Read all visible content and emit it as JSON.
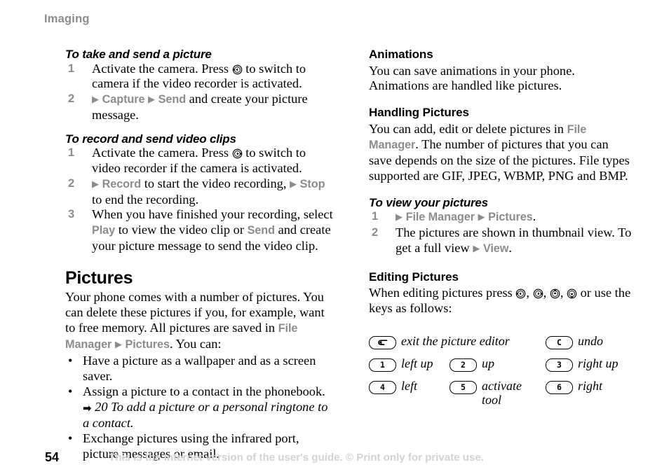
{
  "header": {
    "running_head": "Imaging"
  },
  "left_column": {
    "proc_take_send": {
      "heading": "To take and send a picture",
      "steps": [
        {
          "num": "1",
          "parts": [
            {
              "t": "text",
              "v": "Activate the camera. Press "
            },
            {
              "t": "navkey",
              "v": "nav-key-left"
            },
            {
              "t": "text",
              "v": " to switch to camera if the video recorder is activated."
            }
          ]
        },
        {
          "num": "2",
          "parts": [
            {
              "t": "arrow",
              "v": "▶"
            },
            {
              "t": "kw",
              "v": "Capture"
            },
            {
              "t": "arrow",
              "v": "▶"
            },
            {
              "t": "kw",
              "v": "Send"
            },
            {
              "t": "text",
              "v": " and create your picture message."
            }
          ]
        }
      ]
    },
    "proc_record_send": {
      "heading": "To record and send video clips",
      "steps": [
        {
          "num": "1",
          "parts": [
            {
              "t": "text",
              "v": "Activate the camera. Press "
            },
            {
              "t": "navkey",
              "v": "nav-key-right"
            },
            {
              "t": "text",
              "v": " to switch to video recorder if the camera is activated."
            }
          ]
        },
        {
          "num": "2",
          "parts": [
            {
              "t": "arrow",
              "v": "▶"
            },
            {
              "t": "kw",
              "v": "Record"
            },
            {
              "t": "text",
              "v": " to start the video recording, "
            },
            {
              "t": "arrow",
              "v": "▶"
            },
            {
              "t": "kw",
              "v": "Stop"
            },
            {
              "t": "text",
              "v": " to end the recording."
            }
          ]
        },
        {
          "num": "3",
          "parts": [
            {
              "t": "text",
              "v": "When you have finished your recording, select "
            },
            {
              "t": "kw",
              "v": "Play"
            },
            {
              "t": "text",
              "v": " to view the video clip or "
            },
            {
              "t": "kw",
              "v": "Send"
            },
            {
              "t": "text",
              "v": " and create your picture message to send the video clip."
            }
          ]
        }
      ]
    },
    "pictures": {
      "heading": "Pictures",
      "intro_parts": [
        {
          "t": "text",
          "v": "Your phone comes with a number of pictures. You can delete these pictures if you, for example, want to free memory. All pictures are saved in "
        },
        {
          "t": "kw",
          "v": "File Manager"
        },
        {
          "t": "arrow",
          "v": "▶"
        },
        {
          "t": "kw",
          "v": "Pictures"
        },
        {
          "t": "text",
          "v": ". You can:"
        }
      ],
      "bullets": [
        {
          "parts": [
            {
              "t": "text",
              "v": "Have a picture as a wallpaper and as a screen saver."
            }
          ]
        },
        {
          "parts": [
            {
              "t": "text",
              "v": "Assign a picture to a contact in the phonebook. "
            },
            {
              "t": "xrefarrow",
              "v": "➡"
            },
            {
              "t": "xref",
              "v": " 20 To add a picture or a personal ringtone to a contact."
            }
          ]
        },
        {
          "parts": [
            {
              "t": "text",
              "v": "Exchange pictures using the infrared port, picture messages or email."
            }
          ]
        }
      ]
    }
  },
  "right_column": {
    "animations": {
      "heading": "Animations",
      "body_parts": [
        {
          "t": "text",
          "v": "You can save animations in your phone. Animations are handled like pictures."
        }
      ]
    },
    "handling_pictures": {
      "heading": "Handling Pictures",
      "body_parts": [
        {
          "t": "text",
          "v": "You can add, edit or delete pictures in "
        },
        {
          "t": "kw",
          "v": "File Manager"
        },
        {
          "t": "text",
          "v": ". The number of pictures that you can save depends on the size of the pictures. File types supported are GIF, JPEG, WBMP, PNG and BMP."
        }
      ]
    },
    "proc_view_pictures": {
      "heading": "To view your pictures",
      "steps": [
        {
          "num": "1",
          "parts": [
            {
              "t": "arrow",
              "v": "▶"
            },
            {
              "t": "kw",
              "v": "File Manager"
            },
            {
              "t": "arrow",
              "v": "▶"
            },
            {
              "t": "kw",
              "v": "Pictures"
            },
            {
              "t": "text",
              "v": "."
            }
          ]
        },
        {
          "num": "2",
          "parts": [
            {
              "t": "text",
              "v": "The pictures are shown in thumbnail view. To get a full view "
            },
            {
              "t": "arrow",
              "v": "▶"
            },
            {
              "t": "kw",
              "v": "View"
            },
            {
              "t": "text",
              "v": "."
            }
          ]
        }
      ]
    },
    "editing_pictures": {
      "heading": "Editing Pictures",
      "body_parts": [
        {
          "t": "text",
          "v": "When editing pictures press "
        },
        {
          "t": "navkey",
          "v": "nav-key-left"
        },
        {
          "t": "text",
          "v": ", "
        },
        {
          "t": "navkey",
          "v": "nav-key-right"
        },
        {
          "t": "text",
          "v": ", "
        },
        {
          "t": "navkey",
          "v": "nav-key-up"
        },
        {
          "t": "text",
          "v": ", "
        },
        {
          "t": "navkey",
          "v": "nav-key-down"
        },
        {
          "t": "text",
          "v": " or use the keys as follows:"
        }
      ]
    },
    "key_legend": {
      "rows": [
        [
          {
            "cap": "back-arrow",
            "label": "exit the picture editor",
            "col": 0
          },
          {
            "cap": "C",
            "label": "undo",
            "col": 2
          }
        ],
        [
          {
            "cap": "1",
            "label": "left up",
            "col": 0
          },
          {
            "cap": "2",
            "label": "up",
            "col": 1
          },
          {
            "cap": "3",
            "label": "right up",
            "col": 2
          }
        ],
        [
          {
            "cap": "4",
            "label": "left",
            "col": 0
          },
          {
            "cap": "5",
            "label": "activate\ntool",
            "col": 1
          },
          {
            "cap": "6",
            "label": "right",
            "col": 2
          }
        ]
      ]
    }
  },
  "footer": {
    "page_number": "54",
    "notice": "This is the Internet version of the user's guide. © Print only for private use."
  },
  "colors": {
    "keyword_gray": "#8c8c8c",
    "running_head_gray": "#8c8c8c",
    "footer_gray": "#d2d2d2",
    "text_black": "#000000"
  }
}
